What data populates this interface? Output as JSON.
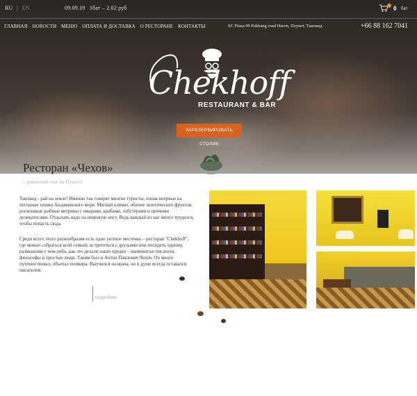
{
  "header": {
    "languages": [
      {
        "label": "RU"
      },
      {
        "label": "EN"
      }
    ],
    "separator": "|",
    "date": "09.09.19",
    "rate": "1бат – 2.02 руб",
    "cart": {
      "count": "0",
      "currency": "бат"
    },
    "nav": [
      {
        "label": "ГЛАВНАЯ"
      },
      {
        "label": "НОВОСТИ"
      },
      {
        "label": "МЕНЮ"
      },
      {
        "label": "ОПЛАТА И ДОСТАВКА"
      },
      {
        "label": "О РЕСТОРАНЕ"
      },
      {
        "label": "КОНТАКТЫ"
      }
    ],
    "address": "SC Piaza 99 Pakbang road Haron, Пхукет, Таиланд",
    "phone": "+66 88 162 7041"
  },
  "hero": {
    "logo_word": "Chekhoff",
    "logo_sub": "RESTAURANT & BAR",
    "reserve_label": "ЗАРЕЗЕРВИРОВАТЬ СТОЛИК"
  },
  "content": {
    "title": "Ресторан «Чехов»",
    "subtitle": "– домашний очаг на Пхукете",
    "paragraph1": "Таиланд - рай на земле! Именно так говорят многие туристы, попав впервые на песчаные пляжи Андаманского моря. Мягкий климат, обилие экзотических фруктов, роскошные рыбные витрины с омарами, крабами, лобстерами и прочими деликатесами. Отдыхать надо на широкую ногу. Ведь каждый из нас много трудился, чтобы попасть сюда.",
    "paragraph2": "Среди всего этого разнообразия есть одно уютное местечко – ресторан \"Chekhoff\", где можно собраться всей семьей, встретиться с друзьями или посидеть одному, размышляя о чем-либо, как это делали наши предки - знаменитые писатели, философы и простые люди. Таким был и Антон Павлович Чехов.  Он много путешествовал, объехал полмира. Выучился на врача, но в душе всегда оставался писателем.",
    "more_label": "подробнее"
  },
  "colors": {
    "accent": "#d9621f",
    "cart_dot": "#e08a2a",
    "text": "#3a3430"
  },
  "icons": [
    "cart-icon",
    "chef-logo-icon"
  ]
}
